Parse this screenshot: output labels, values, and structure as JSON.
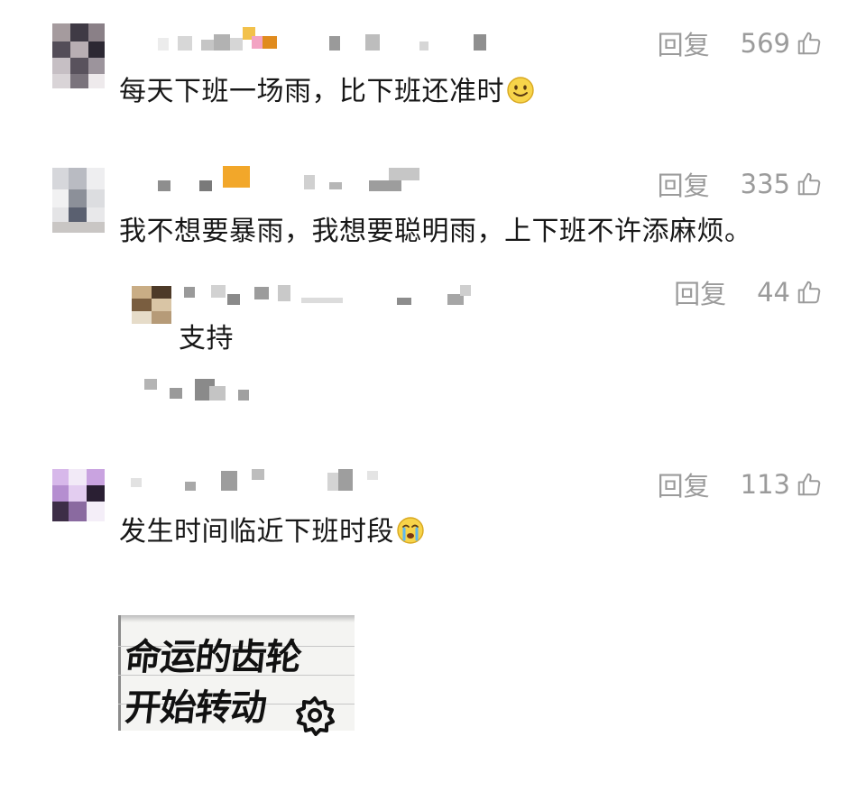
{
  "comments": [
    {
      "reply_label": "回复",
      "likes": "569",
      "text": "每天下班一场雨，比下班还准时",
      "emoji": "smile-emoji"
    },
    {
      "reply_label": "回复",
      "likes": "335",
      "text": "我不想要暴雨，我想要聪明雨，上下班不许添麻烦。"
    },
    {
      "reply_label": "回复",
      "likes": "44",
      "text": "支持"
    },
    {
      "reply_label": "回复",
      "likes": "113",
      "text": "发生时间临近下班时段",
      "emoji": "crying-emoji"
    }
  ],
  "sticker": {
    "line1": "命运的齿轮",
    "line2": "开始转动"
  },
  "icons": {
    "like": "thumbs-up-icon",
    "gear": "gear-icon"
  },
  "colors": {
    "meta_gray": "#9b9b9b",
    "text": "#171717",
    "background": "#ffffff"
  }
}
